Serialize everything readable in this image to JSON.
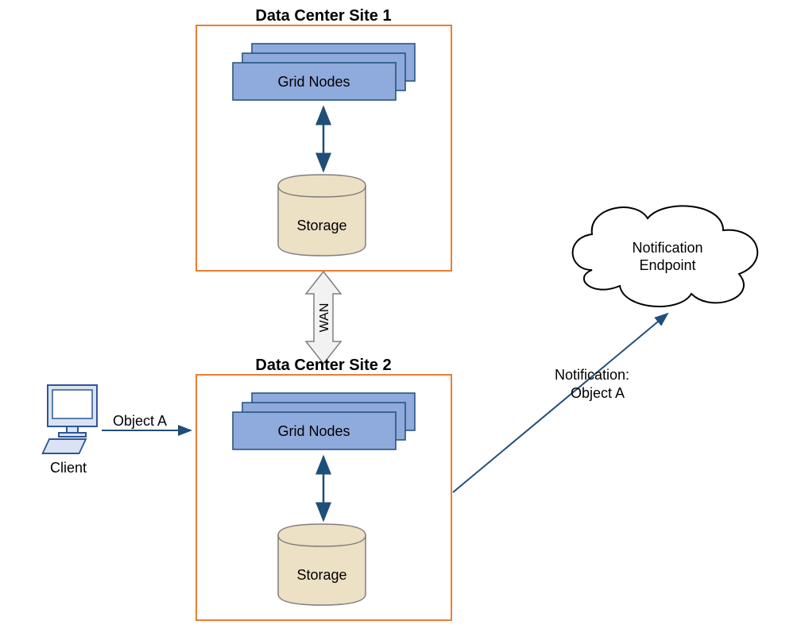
{
  "site1": {
    "title": "Data Center Site 1",
    "node_label": "Grid Nodes",
    "storage_label": "Storage"
  },
  "site2": {
    "title": "Data Center Site 2",
    "node_label": "Grid Nodes",
    "storage_label": "Storage"
  },
  "wan_label": "WAN",
  "client": {
    "label": "Client",
    "object_label": "Object A"
  },
  "cloud": {
    "line1": "Notification",
    "line2": "Endpoint"
  },
  "notification": {
    "line1": "Notification:",
    "line2": "Object A"
  },
  "colors": {
    "site_border": "#ED7D31",
    "node_fill": "#8FAADC",
    "node_stroke": "#4472C4",
    "storage_fill": "#ECE0C5",
    "storage_stroke": "#7F7F7F",
    "arrow_blue": "#1F4E79",
    "wan_fill": "#F2F2F2",
    "wan_stroke": "#7F7F7F",
    "client_fill": "#DAE3F3",
    "client_stroke": "#2F5597"
  }
}
